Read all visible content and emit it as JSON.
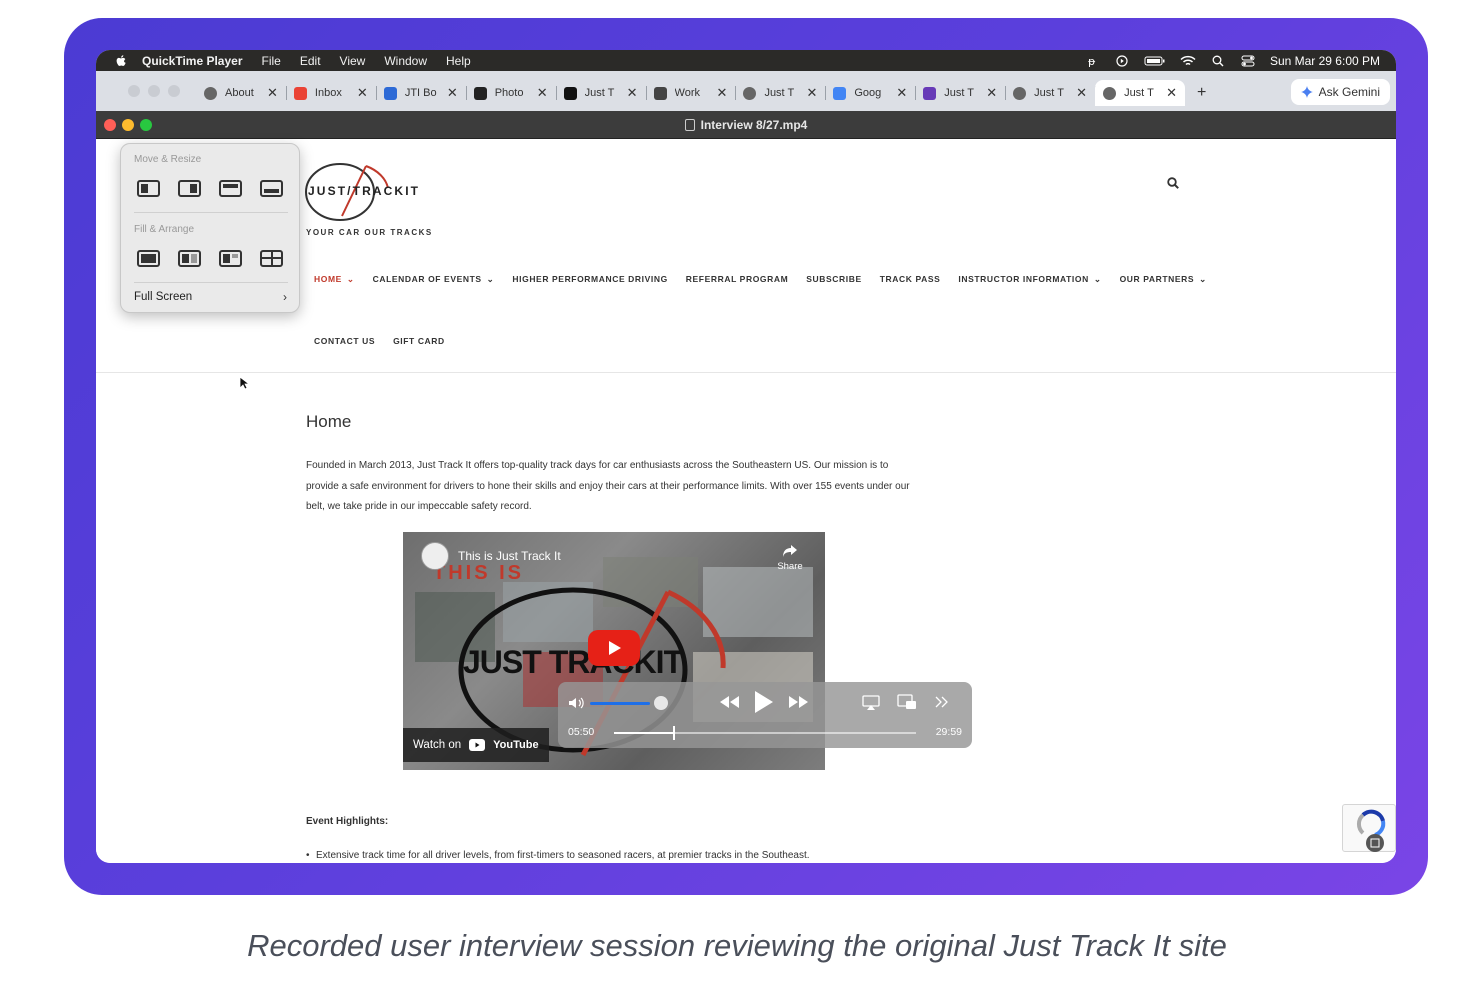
{
  "menubar": {
    "app": "QuickTime Player",
    "items": [
      "File",
      "Edit",
      "View",
      "Window",
      "Help"
    ],
    "clock": "Sun Mar 29  6:00 PM"
  },
  "browser": {
    "tabs": [
      {
        "label": "About",
        "icon": "globe-icon"
      },
      {
        "label": "Inbox",
        "icon": "gmail-icon"
      },
      {
        "label": "JTI Bo",
        "icon": "jti-icon"
      },
      {
        "label": "Photo",
        "icon": "photo-icon"
      },
      {
        "label": "Just T",
        "icon": "jt-icon"
      },
      {
        "label": "Work",
        "icon": "cube-icon"
      },
      {
        "label": "Just T",
        "icon": "globe-icon"
      },
      {
        "label": "Goog",
        "icon": "gdocs-icon"
      },
      {
        "label": "Just T",
        "icon": "forms-icon"
      },
      {
        "label": "Just T",
        "icon": "globe-icon"
      },
      {
        "label": "Just T",
        "icon": "globe-icon",
        "active": true
      }
    ],
    "close_glyph": "✕",
    "new_tab": "+",
    "gemini_label": "Ask Gemini"
  },
  "quicktime": {
    "title": "Interview 8/27.mp4"
  },
  "window_menu": {
    "move_resize": "Move & Resize",
    "fill_arrange": "Fill & Arrange",
    "full_screen": "Full Screen"
  },
  "site": {
    "logo_text": "JUST TRACKIT",
    "tagline": "YOUR CAR OUR TRACKS",
    "nav": [
      "HOME",
      "CALENDAR OF EVENTS",
      "HIGHER PERFORMANCE DRIVING",
      "REFERRAL PROGRAM",
      "SUBSCRIBE",
      "TRACK PASS",
      "INSTRUCTOR INFORMATION",
      "OUR PARTNERS"
    ],
    "nav2": [
      "CONTACT US",
      "GIFT CARD"
    ],
    "dropdown_glyph": "⌄",
    "heading": "Home",
    "intro_lines": [
      "Founded in March 2013, Just Track It offers top-quality track days for car enthusiasts across the Southeastern US. Our mission is to",
      "provide a safe environment for drivers to hone their skills and enjoy their cars at their performance limits. With over 155 events under our",
      "belt, we take pride in our impeccable safety record."
    ],
    "event_heading": "Event Highlights:",
    "bullet": "Extensive track time for all driver levels, from first-timers to seasoned racers, at premier tracks in the Southeast."
  },
  "video": {
    "title": "This is Just Track It",
    "overlay_top": "THIS IS",
    "overlay_logo": "JUST TRACKIT",
    "share": "Share",
    "watch_on": "Watch on",
    "youtube": "YouTube"
  },
  "player": {
    "elapsed": "05:50",
    "total": "29:59",
    "volume_fraction": 0.85,
    "progress_fraction": 0.195
  },
  "caption": "Recorded user interview session reviewing the original Just Track It site",
  "colors": {
    "frame": "#5b3fdc",
    "nav_active": "#c0392b",
    "youtube_red": "#e62117",
    "volume_blue": "#1e6fe8"
  }
}
